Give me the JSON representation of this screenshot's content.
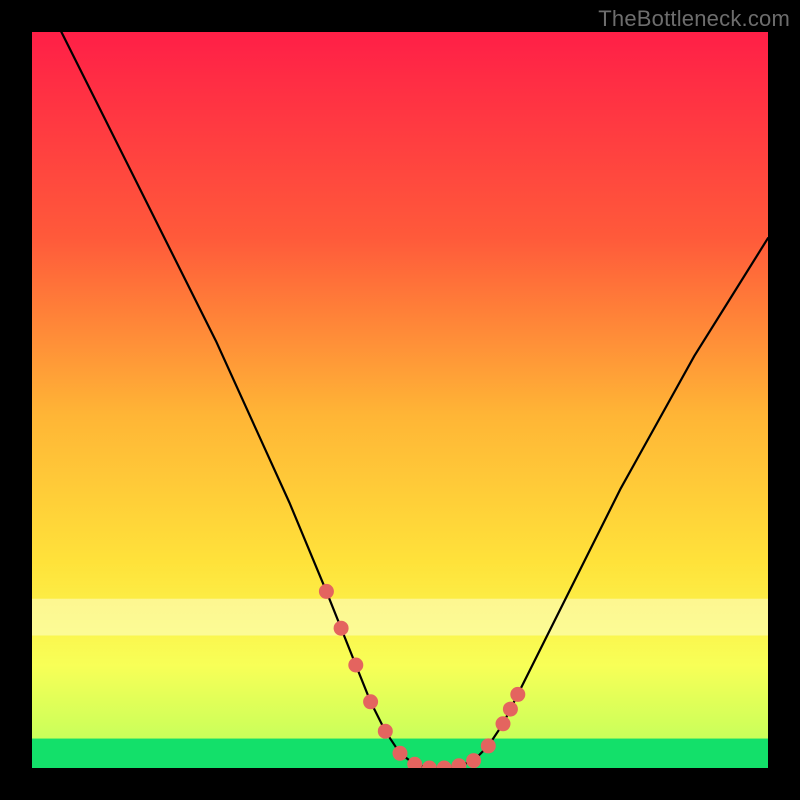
{
  "watermark": "TheBottleneck.com",
  "chart_data": {
    "type": "line",
    "title": "",
    "xlabel": "",
    "ylabel": "",
    "xlim": [
      0,
      100
    ],
    "ylim": [
      0,
      100
    ],
    "series": [
      {
        "name": "curve",
        "x": [
          4,
          10,
          15,
          20,
          25,
          30,
          35,
          40,
          42,
          44,
          46,
          48,
          50,
          52,
          54,
          56,
          58,
          60,
          62,
          64,
          66,
          70,
          75,
          80,
          85,
          90,
          95,
          100
        ],
        "y": [
          100,
          88,
          78,
          68,
          58,
          47,
          36,
          24,
          19,
          14,
          9,
          5,
          2,
          0.5,
          0,
          0,
          0.3,
          1,
          3,
          6,
          10,
          18,
          28,
          38,
          47,
          56,
          64,
          72
        ]
      }
    ],
    "markers": {
      "name": "highlight-points",
      "x": [
        40,
        42,
        44,
        46,
        48,
        50,
        52,
        54,
        56,
        58,
        60,
        62,
        64,
        65,
        66
      ],
      "y": [
        24,
        19,
        14,
        9,
        5,
        2,
        0.5,
        0,
        0,
        0.3,
        1,
        3,
        6,
        8,
        10
      ]
    },
    "bands": [
      {
        "name": "pale-band",
        "y0": 18,
        "y1": 23,
        "color": "#fdffd0",
        "alpha": 0.55
      },
      {
        "name": "green-band",
        "y0": 0,
        "y1": 4,
        "color": "#13e06a",
        "alpha": 1.0
      }
    ],
    "gradient_stops": [
      {
        "offset": 0.0,
        "color": "#ff1f47"
      },
      {
        "offset": 0.28,
        "color": "#ff5a3a"
      },
      {
        "offset": 0.52,
        "color": "#ffb536"
      },
      {
        "offset": 0.72,
        "color": "#ffe23a"
      },
      {
        "offset": 0.86,
        "color": "#f8ff57"
      },
      {
        "offset": 1.0,
        "color": "#b6ff5b"
      }
    ],
    "marker_color": "#e4645f",
    "curve_color": "#000000"
  }
}
